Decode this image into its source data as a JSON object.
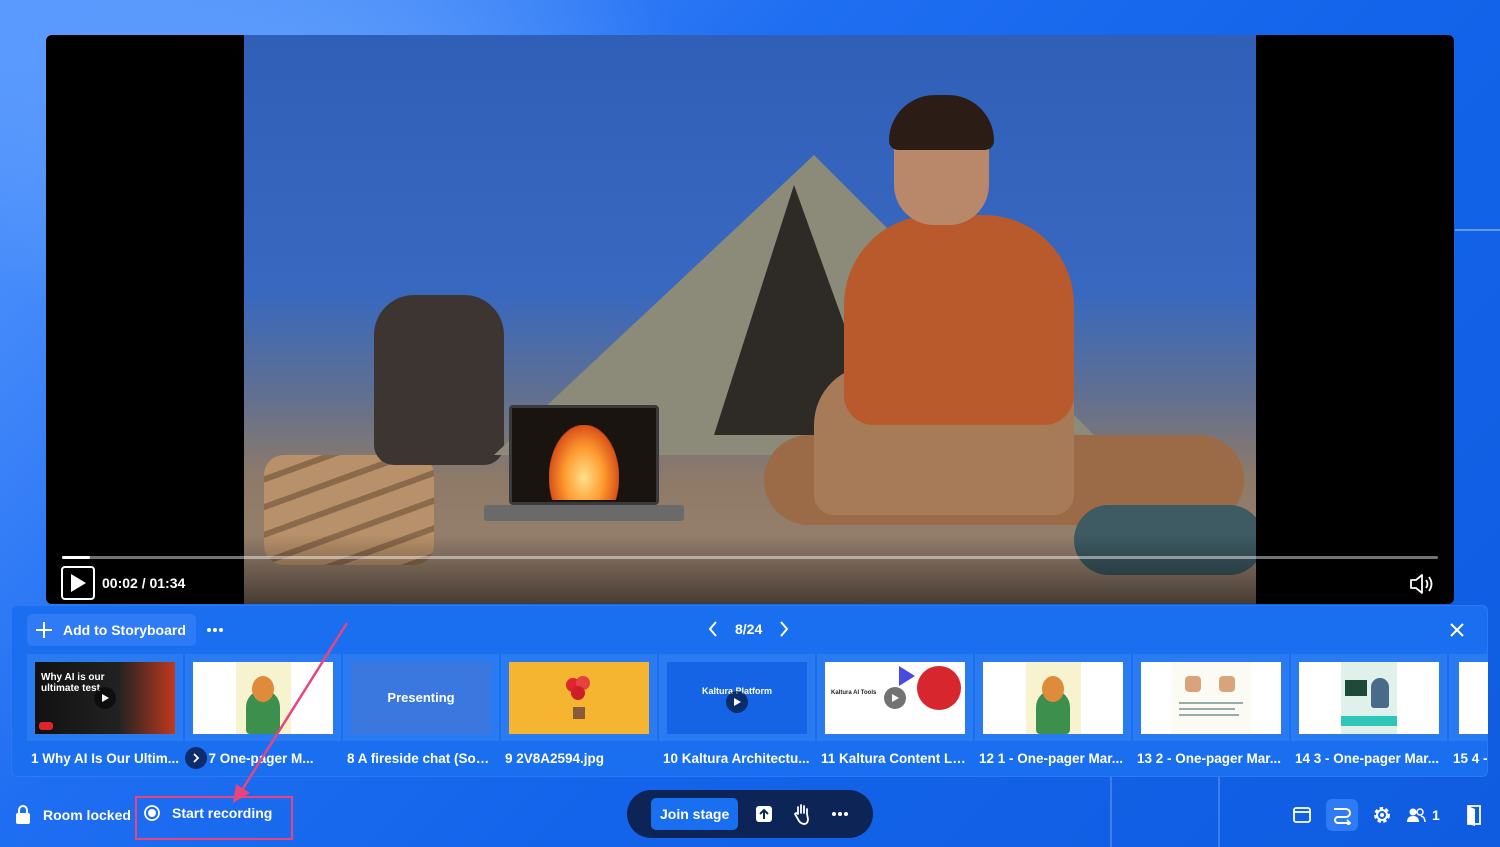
{
  "player": {
    "time": "00:02 / 01:34",
    "progress_fraction": 0.02
  },
  "storyboard": {
    "add_label": "Add to Storyboard",
    "pager": "8/24",
    "items": [
      {
        "label": "1 Why AI Is Our Ultim...",
        "thumb_text": "Why AI is our ultimate test"
      },
      {
        "label": "2 - 7 One-pager M..."
      },
      {
        "label": "8 A fireside chat (Sour...",
        "thumb_text": "Presenting"
      },
      {
        "label": "9 2V8A2594.jpg"
      },
      {
        "label": "10 Kaltura Architectu...",
        "thumb_text": "Kaltura Platform"
      },
      {
        "label": "11 Kaltura Content La...",
        "thumb_text": "Kaltura AI Tools"
      },
      {
        "label": "12 1 - One-pager Mar..."
      },
      {
        "label": "13 2 - One-pager Mar..."
      },
      {
        "label": "14 3 - One-pager Mar..."
      },
      {
        "label": "15 4 -"
      }
    ]
  },
  "bottom": {
    "room_locked": "Room locked",
    "start_recording": "Start recording",
    "join_stage": "Join stage",
    "participant_count": "1"
  },
  "colors": {
    "accent": "#1a6ff0",
    "highlight": "#e8447f",
    "pill": "#0d2556"
  }
}
